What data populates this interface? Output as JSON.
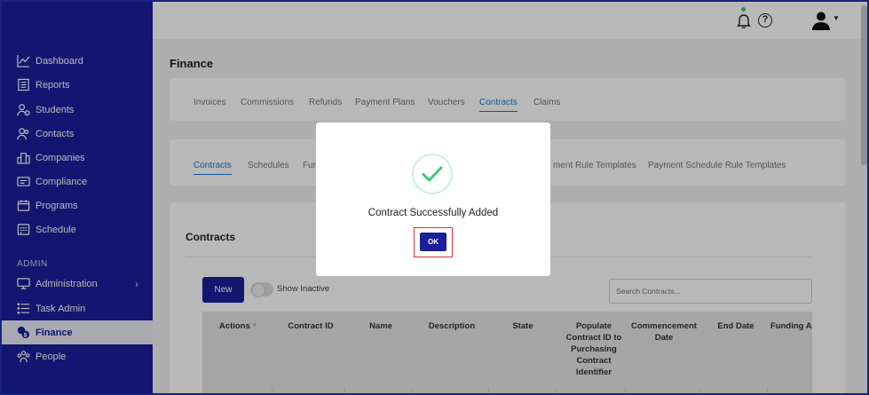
{
  "sidebar": {
    "items": [
      {
        "label": "Dashboard",
        "icon": "chart-line-icon"
      },
      {
        "label": "Reports",
        "icon": "report-icon"
      },
      {
        "label": "Students",
        "icon": "students-icon"
      },
      {
        "label": "Contacts",
        "icon": "contacts-icon"
      },
      {
        "label": "Companies",
        "icon": "building-icon"
      },
      {
        "label": "Compliance",
        "icon": "id-card-icon"
      },
      {
        "label": "Programs",
        "icon": "programs-icon"
      },
      {
        "label": "Schedule",
        "icon": "calendar-icon"
      }
    ],
    "admin_label": "ADMIN",
    "admin_items": [
      {
        "label": "Administration",
        "icon": "monitor-icon"
      },
      {
        "label": "Task Admin",
        "icon": "list-icon"
      },
      {
        "label": "Finance",
        "icon": "finance-icon"
      },
      {
        "label": "People",
        "icon": "people-icon"
      }
    ],
    "active": "Finance"
  },
  "page": {
    "title": "Finance"
  },
  "tabs": [
    "Invoices",
    "Commissions",
    "Refunds",
    "Payment Plans",
    "Vouchers",
    "Contracts",
    "Claims"
  ],
  "active_tab": "Contracts",
  "subtabs": [
    "Contracts",
    "Schedules",
    "Fun",
    "ment Rule Templates",
    "Payment Schedule Rule Templates"
  ],
  "contracts": {
    "title": "Contracts",
    "new_label": "New",
    "toggle_label": "Show Inactive",
    "search_placeholder": "Search Contracts...",
    "columns": [
      "Actions",
      "Contract ID",
      "Name",
      "Description",
      "State",
      "Populate Contract ID to Purchasing Contract Identifier",
      "Commencement Date",
      "End Date",
      "Funding Amou"
    ]
  },
  "modal": {
    "message": "Contract Successfully Added",
    "ok_label": "OK"
  },
  "colors": {
    "sidebar": "#1a1f9c",
    "accent": "#1a7bd6",
    "success": "#2ecc71"
  }
}
